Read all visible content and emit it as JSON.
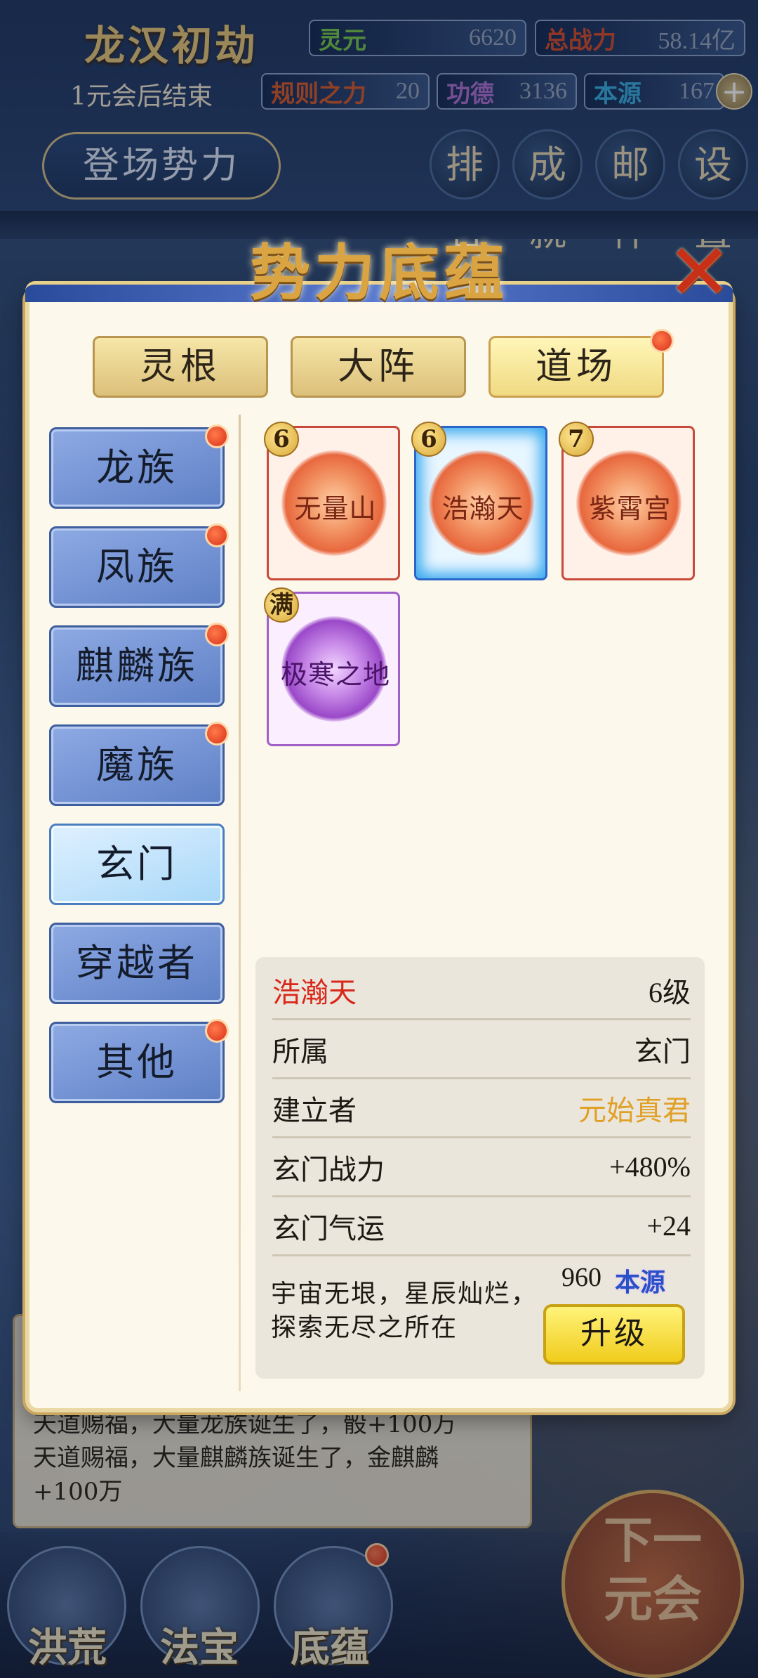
{
  "hud": {
    "era_title": "龙汉初劫",
    "era_sub": "1元会后结束",
    "lingyuan_label": "灵元",
    "lingyuan_value": "6620",
    "zhanli_label": "总战力",
    "zhanli_value": "58.14亿",
    "guize_label": "规则之力",
    "guize_value": "20",
    "gongde_label": "功德",
    "gongde_value": "3136",
    "benyuan_label": "本源",
    "benyuan_value": "167",
    "plus": "+",
    "forces_button": "登场势力",
    "icons": [
      {
        "label": "排名",
        "icon": "ranking-icon"
      },
      {
        "label": "成就",
        "icon": "achievement-icon"
      },
      {
        "label": "邮件",
        "icon": "mail-icon"
      },
      {
        "label": "设置",
        "icon": "settings-icon"
      }
    ]
  },
  "dialog": {
    "title": "势力底蕴",
    "close": "✕",
    "tabs": [
      {
        "label": "灵根",
        "active": false
      },
      {
        "label": "大阵",
        "active": false
      },
      {
        "label": "道场",
        "active": true,
        "dot": true
      }
    ],
    "factions": [
      {
        "label": "龙族",
        "dot": true
      },
      {
        "label": "凤族",
        "dot": true
      },
      {
        "label": "麒麟族",
        "dot": true
      },
      {
        "label": "魔族",
        "dot": true
      },
      {
        "label": "玄门",
        "dot": false,
        "active": true
      },
      {
        "label": "穿越者",
        "dot": false
      },
      {
        "label": "其他",
        "dot": true
      }
    ],
    "cards": [
      {
        "name": "无量山",
        "level": "6",
        "style": "red"
      },
      {
        "name": "浩瀚天",
        "level": "6",
        "style": "selected"
      },
      {
        "name": "紫霄宫",
        "level": "7",
        "style": "red"
      },
      {
        "name": "极寒之地",
        "level": "满",
        "style": "purple"
      }
    ],
    "detail": {
      "name": "浩瀚天",
      "level": "6级",
      "rows": [
        {
          "label": "所属",
          "value": "玄门"
        },
        {
          "label": "建立者",
          "value": "元始真君"
        },
        {
          "label": "玄门战力",
          "value": "+480%"
        },
        {
          "label": "玄门气运",
          "value": "+24"
        }
      ],
      "description_line1": "宇宙无垠，星辰灿烂，",
      "description_line2": "探索无尽之所在",
      "cost_value": "960",
      "cost_unit": "本源",
      "upgrade_label": "升级"
    }
  },
  "log": {
    "line1": "天道赐福，大量龙族诞生了，骰+100万",
    "line2": "天道赐福，大量麒麟族诞生了，金麒麟",
    "line3": "+100万"
  },
  "nav": {
    "items": [
      {
        "label": "洪荒"
      },
      {
        "label": "法宝"
      },
      {
        "label": "底蕴"
      }
    ],
    "next_label": "下一元会"
  }
}
